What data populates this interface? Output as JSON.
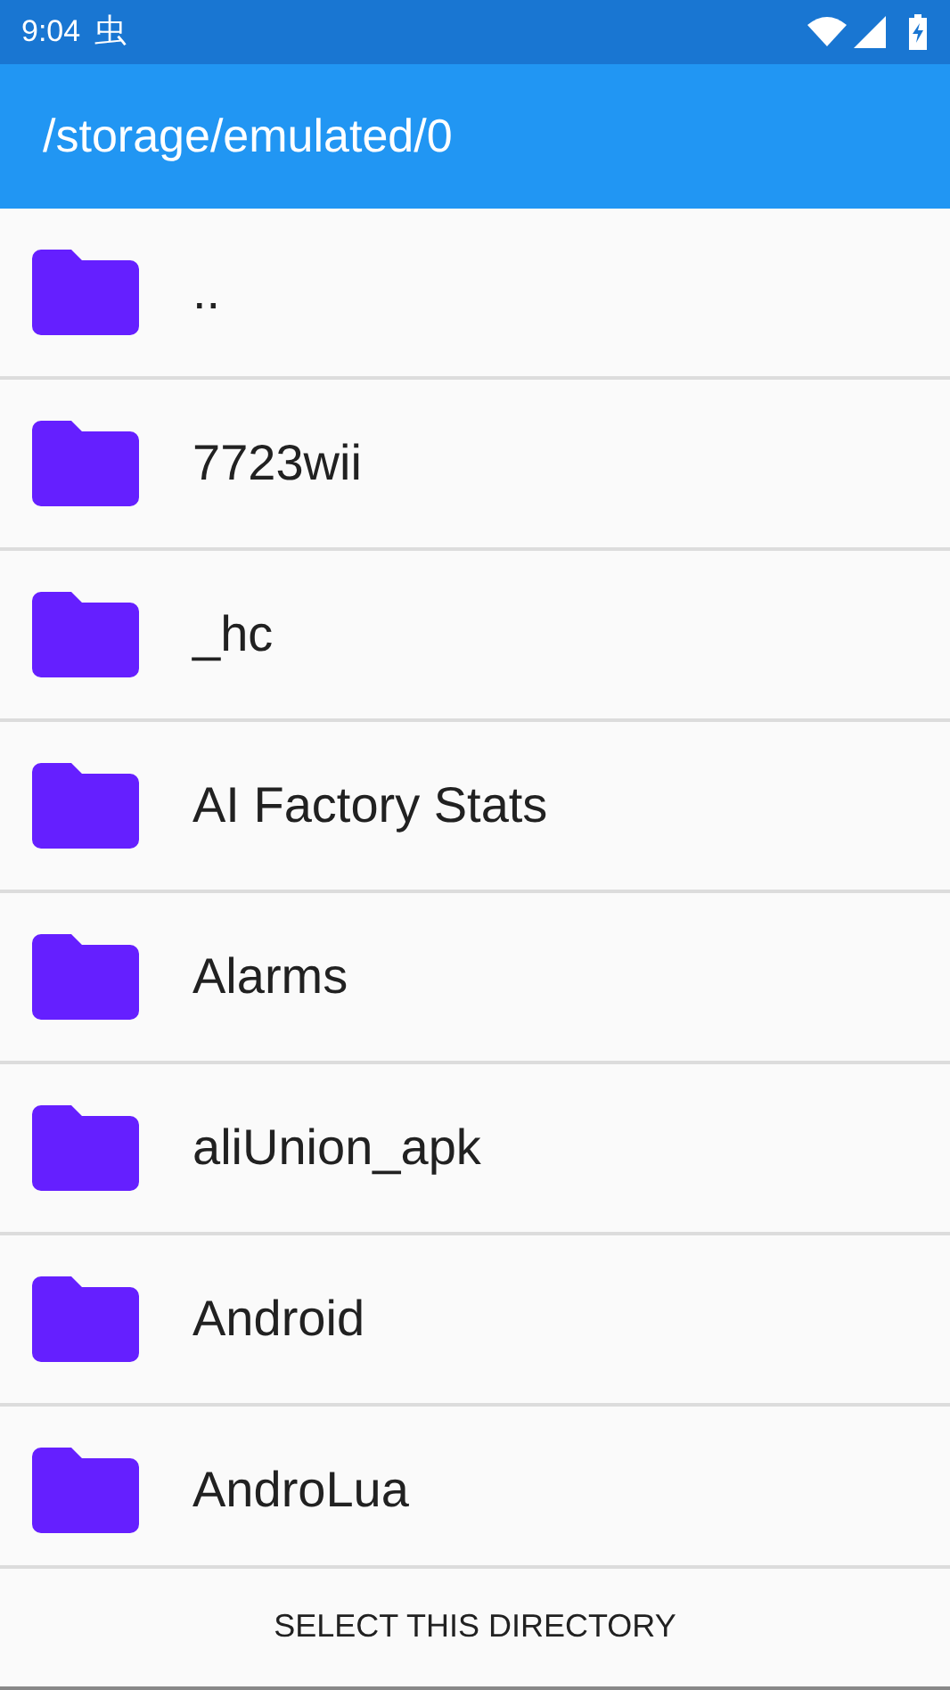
{
  "status_bar": {
    "time": "9:04",
    "notification": "虫"
  },
  "app_bar": {
    "title": "/storage/emulated/0"
  },
  "folders": [
    {
      "name": ".."
    },
    {
      "name": "7723wii"
    },
    {
      "name": "_hc"
    },
    {
      "name": "AI Factory Stats"
    },
    {
      "name": "Alarms"
    },
    {
      "name": "aliUnion_apk"
    },
    {
      "name": "Android"
    },
    {
      "name": "AndroLua"
    }
  ],
  "button": {
    "label": "SELECT THIS DIRECTORY"
  }
}
